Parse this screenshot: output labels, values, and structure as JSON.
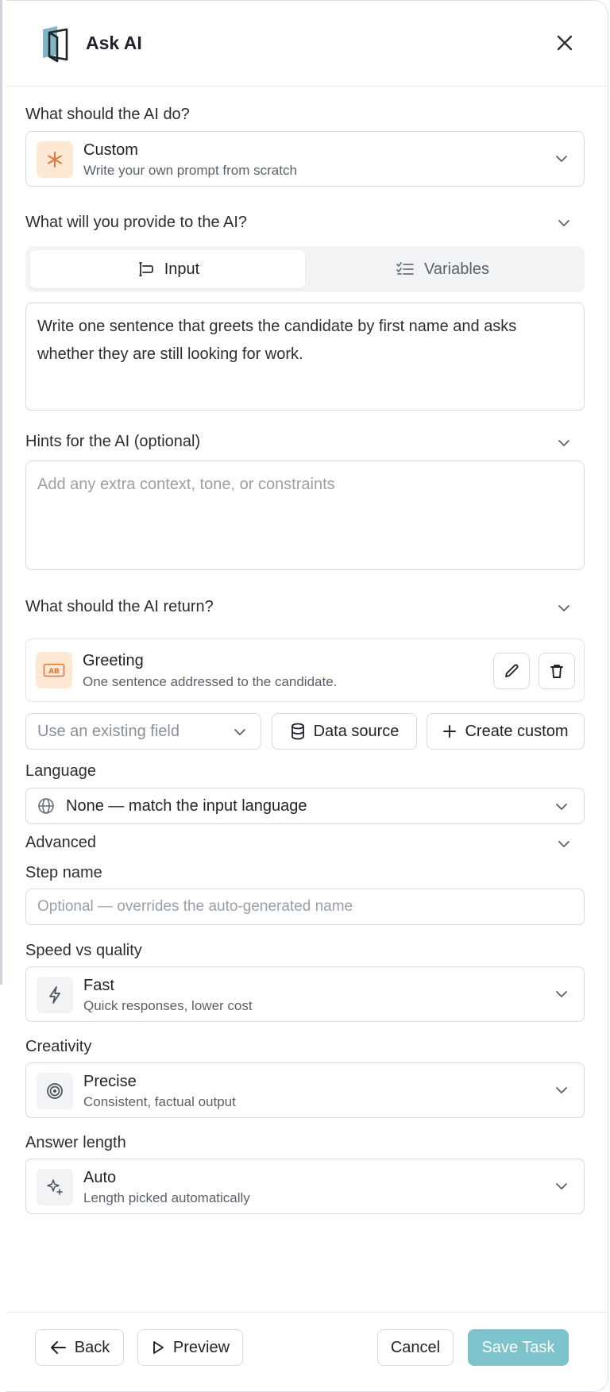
{
  "header": {
    "title": "Ask AI"
  },
  "task": {
    "label": "What should the AI do?",
    "selected": {
      "title": "Custom",
      "subtitle": "Write your own prompt from scratch",
      "icon": "asterisk-icon",
      "icon_color": "#e0773a"
    }
  },
  "provide": {
    "label": "What will you provide to the AI?",
    "tabs": [
      {
        "label": "Input",
        "icon": "text-cursor-icon",
        "active": true
      },
      {
        "label": "Variables",
        "icon": "checklist-icon",
        "active": false
      }
    ],
    "input_value": "Write one sentence that greets the candidate by first name and asks whether they are still looking for work."
  },
  "hints": {
    "label": "Hints for the AI (optional)",
    "placeholder": "Add any extra context, tone, or constraints"
  },
  "returns": {
    "label": "What should the AI return?",
    "output": {
      "title": "Greeting",
      "subtitle": "One sentence addressed to the candidate.",
      "icon": "text-field-icon"
    },
    "existing_field_placeholder": "Use an existing field",
    "data_source_label": "Data source",
    "create_custom_label": "Create custom"
  },
  "language": {
    "label": "Language",
    "selected": "None — match the input language"
  },
  "advanced": {
    "label": "Advanced",
    "step_name": {
      "label": "Step name",
      "placeholder": "Optional — overrides the auto-generated name"
    },
    "speed": {
      "label": "Speed vs quality",
      "title": "Fast",
      "subtitle": "Quick responses, lower cost",
      "icon": "lightning-icon"
    },
    "creativity": {
      "label": "Creativity",
      "title": "Precise",
      "subtitle": "Consistent, factual output",
      "icon": "target-icon"
    },
    "length": {
      "label": "Answer length",
      "title": "Auto",
      "subtitle": "Length picked automatically",
      "icon": "sparkle-icon"
    }
  },
  "footer": {
    "back_label": "Back",
    "preview_label": "Preview",
    "cancel_label": "Cancel",
    "save_label": "Save Task"
  },
  "colors": {
    "accent": "#7cc3cc",
    "orange_icon_bg": "#fde8d4",
    "orange_icon": "#e0773a"
  }
}
